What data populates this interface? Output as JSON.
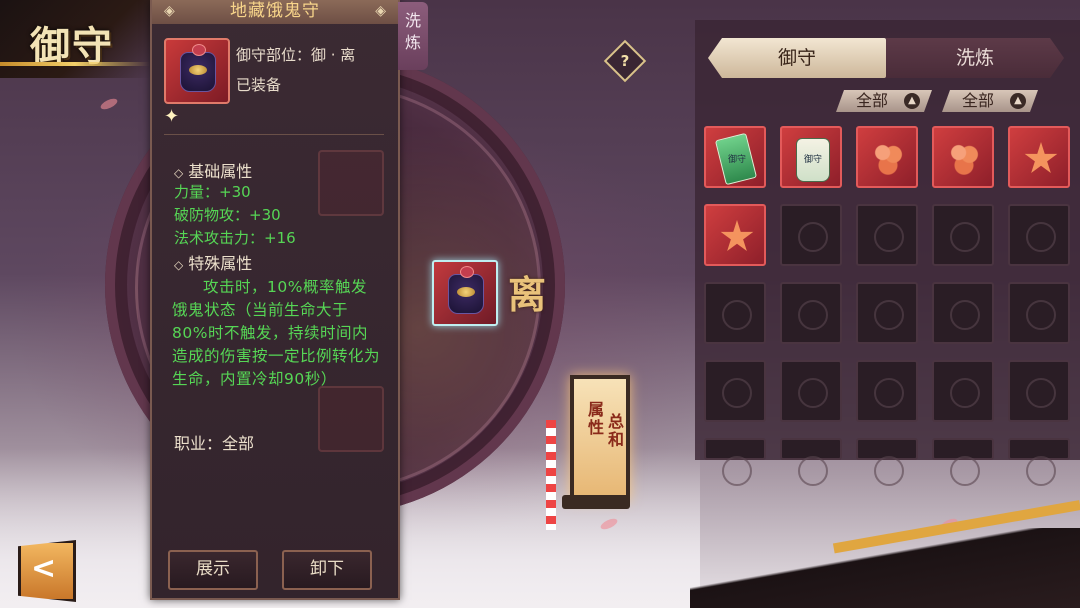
{
  "screen": {
    "title": "御守"
  },
  "item_detail": {
    "name": "地藏饿鬼守",
    "slot_line": "御守部位：御 · 离",
    "equipped_status": "已装备",
    "base_title": "基础属性",
    "base_stats": [
      "力量：+30",
      "破防物攻：+30",
      "法术攻击力：+16"
    ],
    "special_title": "特殊属性",
    "special_text": "攻击时，10%概率触发饿鬼状态（当前生命大于80%时不触发，持续时间内造成的伤害按一定比例转化为生命，内置冷却90秒）",
    "job_line": "职业：全部",
    "buttons": {
      "show": "展示",
      "unequip": "卸下"
    }
  },
  "side_tab": {
    "label": "洗炼"
  },
  "help_icon": "?",
  "equip_wheel": {
    "position_label": "离"
  },
  "lantern": {
    "label_line1": "属性",
    "label_line2": "总和"
  },
  "inventory": {
    "tabs": [
      "御守",
      "洗炼"
    ],
    "active_tab": "御守",
    "filters": [
      "全部",
      "全部"
    ],
    "items": [
      {
        "type": "green-tag",
        "text": "御守"
      },
      {
        "type": "white-tag",
        "text": "御守"
      },
      {
        "type": "flowers"
      },
      {
        "type": "flowers"
      },
      {
        "type": "star"
      },
      {
        "type": "star"
      }
    ]
  },
  "colors": {
    "stat_green": "#56d655",
    "gold": "#f7d48a",
    "accent_red": "#cf3e3f"
  }
}
